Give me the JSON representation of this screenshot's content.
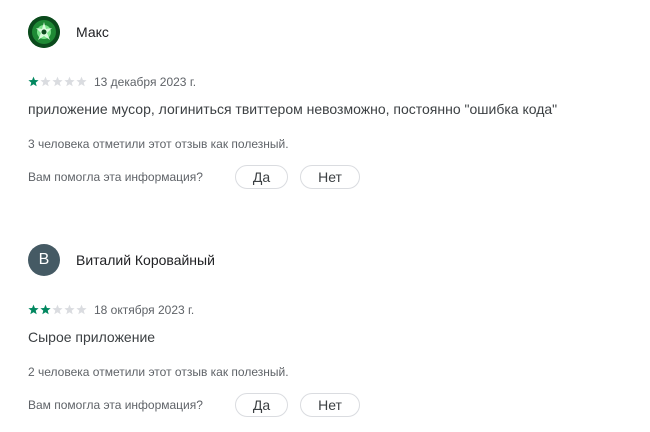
{
  "reviews": [
    {
      "author": "Макс",
      "avatar_letter": "",
      "rating": 1,
      "max_rating": 5,
      "date": "13 декабря 2023 г.",
      "text": "приложение мусор, логиниться твиттером невозможно, постоянно \"ошибка кода\"",
      "helpful_count_text": "3 человека отметили этот отзыв как полезный.",
      "helpful_question": "Вам помогла эта информация?",
      "yes_label": "Да",
      "no_label": "Нет"
    },
    {
      "author": "Виталий Коровайный",
      "avatar_letter": "В",
      "rating": 2,
      "max_rating": 5,
      "date": "18 октября 2023 г.",
      "text": "Сырое приложение",
      "helpful_count_text": "2 человека отметили этот отзыв как полезный.",
      "helpful_question": "Вам помогла эта информация?",
      "yes_label": "Да",
      "no_label": "Нет"
    }
  ],
  "colors": {
    "star_filled": "#01875f",
    "star_empty": "#dadce0",
    "avatar_letter_bg": "#455a64"
  },
  "icons": {
    "star": "star-icon"
  }
}
